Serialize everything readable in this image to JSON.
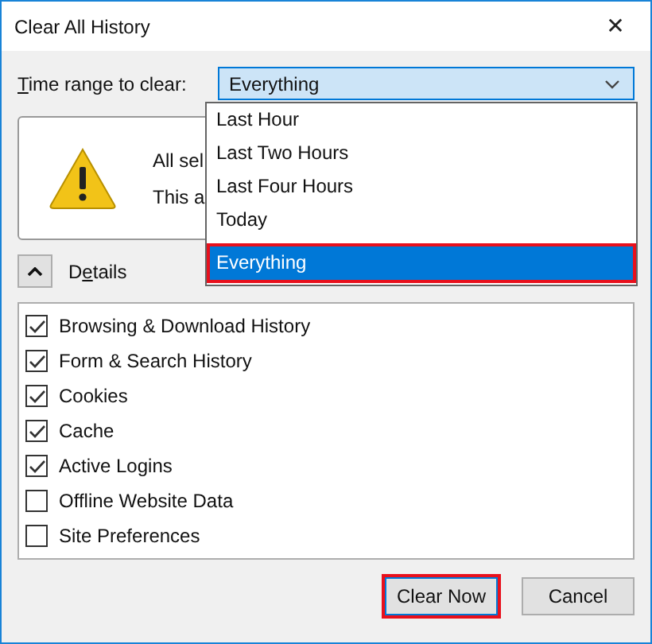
{
  "window": {
    "title": "Clear All History",
    "close": "✕"
  },
  "time_range": {
    "label_key": "T",
    "label_rest": "ime range to clear:",
    "value": "Everything",
    "expanded": true,
    "options": [
      {
        "label": "Last Hour",
        "selected": false,
        "highlighted": false
      },
      {
        "label": "Last Two Hours",
        "selected": false,
        "highlighted": false
      },
      {
        "label": "Last Four Hours",
        "selected": false,
        "highlighted": false
      },
      {
        "label": "Today",
        "selected": false,
        "highlighted": false
      },
      {
        "label": "Everything",
        "selected": true,
        "highlighted": true
      }
    ]
  },
  "warning": {
    "lines": [
      "All sel",
      "This a"
    ]
  },
  "details": {
    "label_start": "D",
    "label_key": "e",
    "label_rest": "tails",
    "expanded": true
  },
  "items": [
    {
      "label": "Browsing & Download History",
      "checked": true
    },
    {
      "label": "Form & Search History",
      "checked": true
    },
    {
      "label": "Cookies",
      "checked": true
    },
    {
      "label": "Cache",
      "checked": true
    },
    {
      "label": "Active Logins",
      "checked": true
    },
    {
      "label": "Offline Website Data",
      "checked": false
    },
    {
      "label": "Site Preferences",
      "checked": false
    }
  ],
  "buttons": [
    {
      "label": "Clear Now",
      "highlighted": true
    },
    {
      "label": "Cancel",
      "highlighted": false
    }
  ]
}
